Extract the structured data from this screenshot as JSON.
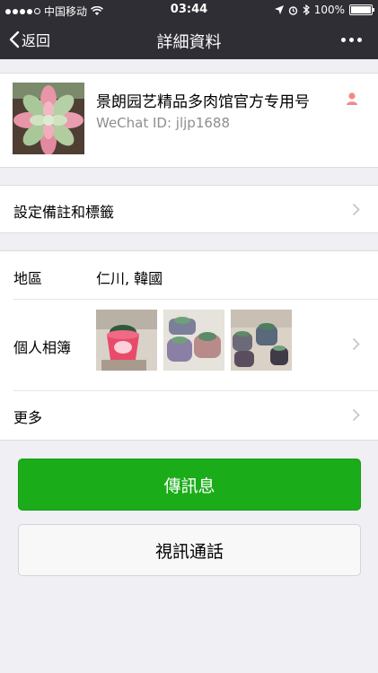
{
  "status_bar": {
    "carrier": "中国移动",
    "time": "03:44",
    "battery": "100%"
  },
  "navbar": {
    "back_label": "返回",
    "title": "詳細資料"
  },
  "profile": {
    "name": "景朗园艺精品多肉馆官方专用号",
    "wechat_id": "WeChat ID: jljp1688"
  },
  "remark": {
    "label": "設定備註和標籤"
  },
  "details": {
    "region_label": "地區",
    "region_value": "仁川, 韓國",
    "album_label": "個人相簿",
    "more_label": "更多"
  },
  "actions": {
    "message_label": "傳訊息",
    "video_call_label": "視訊通話"
  },
  "colors": {
    "nav_bg": "#2e2e34",
    "primary_button": "#1aad19",
    "page_bg": "#efeff4"
  }
}
